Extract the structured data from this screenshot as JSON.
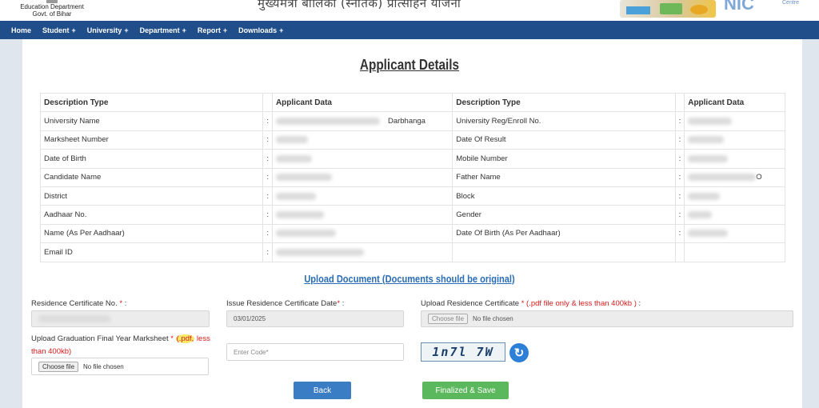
{
  "header": {
    "dept_line1": "Education Department",
    "dept_line2": "Govt. of Bihar",
    "scheme_title": "मुख्यमंत्री बालिका (स्नातक) प्रोत्साहन योजना",
    "logo_text": "NIC",
    "logo_sub": "Centre"
  },
  "nav": {
    "items": [
      {
        "label": "Home",
        "dropdown": false
      },
      {
        "label": "Student",
        "dropdown": true
      },
      {
        "label": "University",
        "dropdown": true
      },
      {
        "label": "Department",
        "dropdown": true
      },
      {
        "label": "Report",
        "dropdown": true
      },
      {
        "label": "Downloads",
        "dropdown": true
      }
    ],
    "caret": "+"
  },
  "page_title": "Applicant Details",
  "table": {
    "headers": [
      "Description Type",
      "Applicant Data",
      "Description Type",
      "Applicant Data"
    ],
    "separator": ":",
    "rows": [
      {
        "left_label": "University Name",
        "left_suffix": "Darbhanga",
        "right_label": "University Reg/Enroll No.",
        "right_suffix": ""
      },
      {
        "left_label": "Marksheet Number",
        "left_suffix": "",
        "right_label": "Date Of Result",
        "right_suffix": ""
      },
      {
        "left_label": "Date of Birth",
        "left_suffix": "",
        "right_label": "Mobile Number",
        "right_suffix": ""
      },
      {
        "left_label": "Candidate Name",
        "left_suffix": "",
        "right_label": "Father Name",
        "right_suffix": "O"
      },
      {
        "left_label": "District",
        "left_suffix": "",
        "right_label": "Block",
        "right_suffix": ""
      },
      {
        "left_label": "Aadhaar No.",
        "left_suffix": "",
        "right_label": "Gender",
        "right_suffix": ""
      },
      {
        "left_label": "Name (As Per Aadhaar)",
        "left_suffix": "",
        "right_label": "Date Of Birth (As Per Aadhaar)",
        "right_suffix": ""
      },
      {
        "left_label": "Email ID",
        "left_suffix": "",
        "right_label": "",
        "right_suffix": ""
      }
    ]
  },
  "upload_heading": "Upload Document (Documents should be original)",
  "form": {
    "residence_no_label": "Residence Certificate No.",
    "required_mark": "*",
    "colon": ":",
    "issue_date_label": "Issue Residence Certificate Date",
    "issue_date_value": "03/01/2025",
    "upload_residence_label": "Upload Residence Certificate",
    "upload_residence_note": "(.pdf file only & less than 400kb )",
    "upload_marksheet_label": "Upload Graduation Final Year Marksheet",
    "upload_marksheet_note_a": "(.pdf,",
    "upload_marksheet_note_b": "less than 400kb)",
    "choose_file": "Choose file",
    "no_file": "No file chosen",
    "code_placeholder": "Enter Code*",
    "captcha_text": "1n7l 7W"
  },
  "buttons": {
    "back": "Back",
    "finalize": "Finalized & Save"
  },
  "colors": {
    "navbar": "#1f4e8a",
    "heading_link": "#2a6db5",
    "back_button": "#3b7dc4",
    "save_button": "#5cb85c",
    "required": "#d61b1b"
  }
}
